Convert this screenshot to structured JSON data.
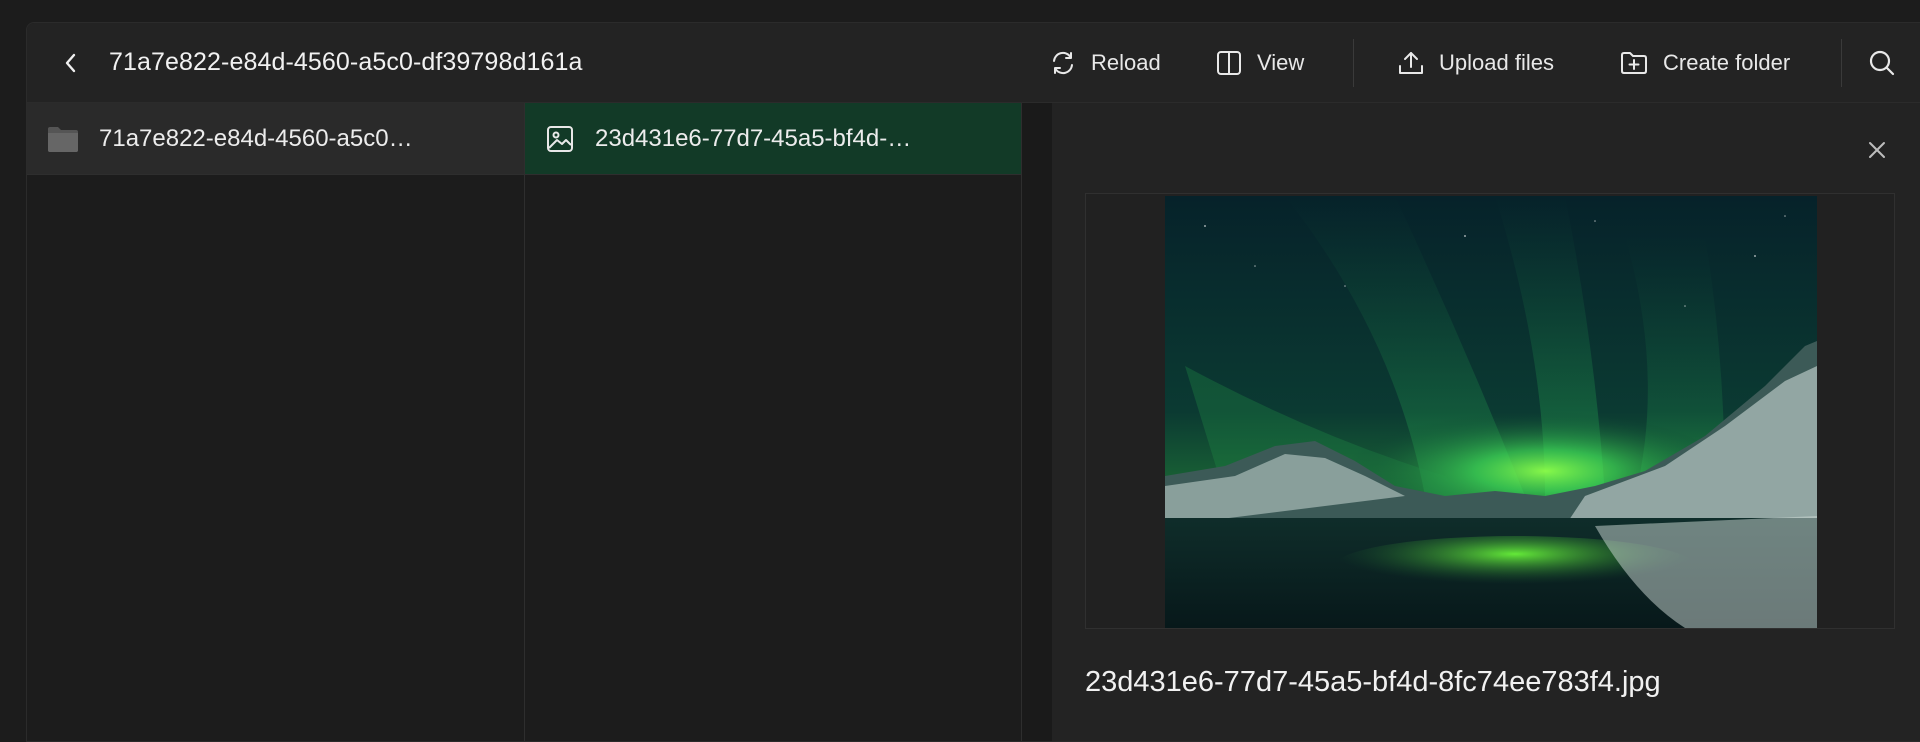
{
  "toolbar": {
    "path_title": "71a7e822-e84d-4560-a5c0-df39798d161a",
    "reload_label": "Reload",
    "view_label": "View",
    "upload_label": "Upload files",
    "create_folder_label": "Create folder"
  },
  "columns": {
    "folder_item": {
      "label": "71a7e822-e84d-4560-a5c0…",
      "icon": "folder-icon"
    },
    "file_item": {
      "label": "23d431e6-77d7-45a5-bf4d-…",
      "icon": "image-icon"
    }
  },
  "preview": {
    "filename": "23d431e6-77d7-45a5-bf4d-8fc74ee783f4.jpg",
    "image_alt": "aurora borealis over snowy mountains"
  },
  "colors": {
    "background": "#1c1c1c",
    "toolbar": "#232323",
    "selected_row": "#123a27",
    "folder_row": "#2a2a2a",
    "text": "#ececec"
  }
}
